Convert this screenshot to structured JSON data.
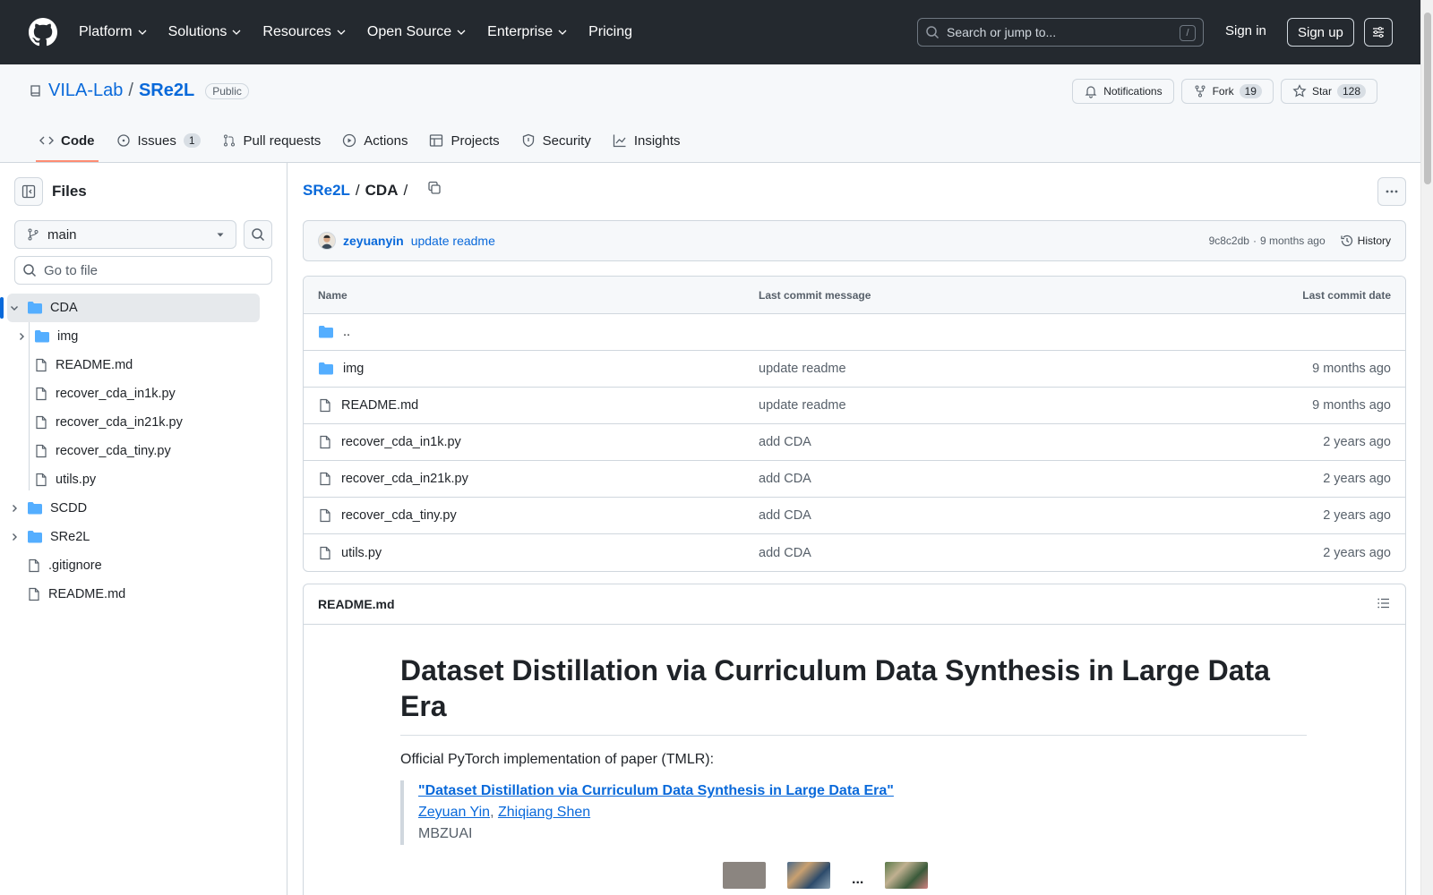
{
  "header": {
    "nav": [
      "Platform",
      "Solutions",
      "Resources",
      "Open Source",
      "Enterprise",
      "Pricing"
    ],
    "search_placeholder": "Search or jump to...",
    "search_shortcut": "/",
    "signin": "Sign in",
    "signup": "Sign up"
  },
  "repo": {
    "owner": "VILA-Lab",
    "name": "SRe2L",
    "visibility": "Public",
    "notifications": "Notifications",
    "fork_label": "Fork",
    "fork_count": "19",
    "star_label": "Star",
    "star_count": "128",
    "tabs": [
      {
        "label": "Code",
        "counter": ""
      },
      {
        "label": "Issues",
        "counter": "1"
      },
      {
        "label": "Pull requests",
        "counter": ""
      },
      {
        "label": "Actions",
        "counter": ""
      },
      {
        "label": "Projects",
        "counter": ""
      },
      {
        "label": "Security",
        "counter": ""
      },
      {
        "label": "Insights",
        "counter": ""
      }
    ]
  },
  "sidebar": {
    "title": "Files",
    "branch": "main",
    "goto_placeholder": "Go to file",
    "tree": [
      {
        "label": "CDA",
        "type": "folder",
        "expanded": true
      },
      {
        "label": "img",
        "type": "folder"
      },
      {
        "label": "README.md",
        "type": "file"
      },
      {
        "label": "recover_cda_in1k.py",
        "type": "file"
      },
      {
        "label": "recover_cda_in21k.py",
        "type": "file"
      },
      {
        "label": "recover_cda_tiny.py",
        "type": "file"
      },
      {
        "label": "utils.py",
        "type": "file"
      },
      {
        "label": "SCDD",
        "type": "folder"
      },
      {
        "label": "SRe2L",
        "type": "folder"
      },
      {
        "label": ".gitignore",
        "type": "file"
      },
      {
        "label": "README.md",
        "type": "file"
      }
    ]
  },
  "breadcrumb": {
    "root": "SRe2L",
    "sep": "/",
    "current": "CDA",
    "trail": "/"
  },
  "commit": {
    "author": "zeyuanyin",
    "message": "update readme",
    "hash": "9c8c2db",
    "dot": "·",
    "age": "9 months ago",
    "history": "History"
  },
  "files_table": {
    "headers": {
      "name": "Name",
      "message": "Last commit message",
      "date": "Last commit date"
    },
    "rows": [
      {
        "name": "..",
        "type": "folder",
        "message": "",
        "date": ""
      },
      {
        "name": "img",
        "type": "folder",
        "message": "update readme",
        "date": "9 months ago"
      },
      {
        "name": "README.md",
        "type": "file",
        "message": "update readme",
        "date": "9 months ago"
      },
      {
        "name": "recover_cda_in1k.py",
        "type": "file",
        "message": "add CDA",
        "date": "2 years ago"
      },
      {
        "name": "recover_cda_in21k.py",
        "type": "file",
        "message": "add CDA",
        "date": "2 years ago"
      },
      {
        "name": "recover_cda_tiny.py",
        "type": "file",
        "message": "add CDA",
        "date": "2 years ago"
      },
      {
        "name": "utils.py",
        "type": "file",
        "message": "add CDA",
        "date": "2 years ago"
      }
    ]
  },
  "readme": {
    "filename": "README.md",
    "heading": "Dataset Distillation via Curriculum Data Synthesis in Large Data Era",
    "intro": "Official PyTorch implementation of paper (TMLR):",
    "paper_title": "\"Dataset Distillation via Curriculum Data Synthesis in Large Data Era\"",
    "author1": "Zeyuan Yin",
    "author_sep": ",",
    "author2": "Zhiqiang Shen",
    "affiliation": "MBZUAI",
    "ellipsis": "..."
  },
  "colors": {
    "header_bg": "#24292f",
    "link": "#0969da",
    "active_tab_underline": "#fd8c73",
    "folder": "#54aeff"
  }
}
